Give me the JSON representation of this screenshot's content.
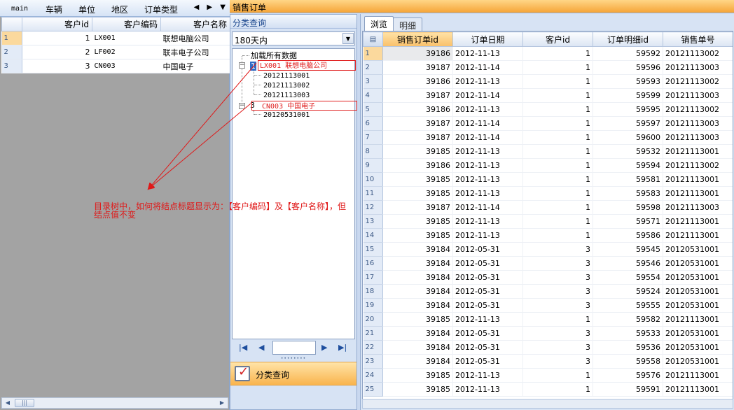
{
  "tabs": [
    {
      "label": "main"
    },
    {
      "label": "车辆"
    },
    {
      "label": "单位"
    },
    {
      "label": "地区"
    },
    {
      "label": "订单类型"
    }
  ],
  "tab_scroll_glyphs": "◀ ▶ ▼",
  "customer_grid": {
    "headers": [
      "客户id",
      "客户编码",
      "客户名称"
    ],
    "rows": [
      {
        "n": "1",
        "id": "1",
        "code": "LX001",
        "name": "联想电脑公司"
      },
      {
        "n": "2",
        "id": "2",
        "code": "LF002",
        "name": "联丰电子公司"
      },
      {
        "n": "3",
        "id": "3",
        "code": "CN003",
        "name": "中国电子"
      }
    ]
  },
  "window_title": "销售订单",
  "category_panel": {
    "title": "分类查询",
    "filter_value": "180天内",
    "tree": {
      "root_label": "加载所有数据",
      "node1_key": "1",
      "node1_caption": "LX001 联想电脑公司",
      "node1_children": [
        "20121113001",
        "20121113002",
        "20121113003"
      ],
      "node2_key": "3",
      "node2_caption": "CN003 中国电子",
      "node2_children": [
        "20120531001"
      ]
    },
    "action_label": "分类查询"
  },
  "order_tabs": {
    "browse": "浏览",
    "detail": "明细"
  },
  "order_grid": {
    "headers": [
      "销售订单id",
      "订单日期",
      "客户id",
      "订单明细id",
      "销售单号"
    ],
    "rows": [
      [
        "1",
        "39186",
        "2012-11-13",
        "1",
        "59592",
        "20121113002"
      ],
      [
        "2",
        "39187",
        "2012-11-14",
        "1",
        "59596",
        "20121113003"
      ],
      [
        "3",
        "39186",
        "2012-11-13",
        "1",
        "59593",
        "20121113002"
      ],
      [
        "4",
        "39187",
        "2012-11-14",
        "1",
        "59599",
        "20121113003"
      ],
      [
        "5",
        "39186",
        "2012-11-13",
        "1",
        "59595",
        "20121113002"
      ],
      [
        "6",
        "39187",
        "2012-11-14",
        "1",
        "59597",
        "20121113003"
      ],
      [
        "7",
        "39187",
        "2012-11-14",
        "1",
        "59600",
        "20121113003"
      ],
      [
        "8",
        "39185",
        "2012-11-13",
        "1",
        "59532",
        "20121113001"
      ],
      [
        "9",
        "39186",
        "2012-11-13",
        "1",
        "59594",
        "20121113002"
      ],
      [
        "10",
        "39185",
        "2012-11-13",
        "1",
        "59581",
        "20121113001"
      ],
      [
        "11",
        "39185",
        "2012-11-13",
        "1",
        "59583",
        "20121113001"
      ],
      [
        "12",
        "39187",
        "2012-11-14",
        "1",
        "59598",
        "20121113003"
      ],
      [
        "13",
        "39185",
        "2012-11-13",
        "1",
        "59571",
        "20121113001"
      ],
      [
        "14",
        "39185",
        "2012-11-13",
        "1",
        "59586",
        "20121113001"
      ],
      [
        "15",
        "39184",
        "2012-05-31",
        "3",
        "59545",
        "20120531001"
      ],
      [
        "16",
        "39184",
        "2012-05-31",
        "3",
        "59546",
        "20120531001"
      ],
      [
        "17",
        "39184",
        "2012-05-31",
        "3",
        "59554",
        "20120531001"
      ],
      [
        "18",
        "39184",
        "2012-05-31",
        "3",
        "59524",
        "20120531001"
      ],
      [
        "19",
        "39184",
        "2012-05-31",
        "3",
        "59555",
        "20120531001"
      ],
      [
        "20",
        "39185",
        "2012-11-13",
        "1",
        "59582",
        "20121113001"
      ],
      [
        "21",
        "39184",
        "2012-05-31",
        "3",
        "59533",
        "20120531001"
      ],
      [
        "22",
        "39184",
        "2012-05-31",
        "3",
        "59536",
        "20120531001"
      ],
      [
        "23",
        "39184",
        "2012-05-31",
        "3",
        "59558",
        "20120531001"
      ],
      [
        "24",
        "39185",
        "2012-11-13",
        "1",
        "59576",
        "20121113001"
      ],
      [
        "25",
        "39185",
        "2012-11-13",
        "1",
        "59591",
        "20121113001"
      ]
    ]
  },
  "annotation": {
    "line1": "目录树中，如何将结点标题显示为：【客户编码】及【客户名称】，但",
    "line2": "结点值不变",
    "color": "#e01818"
  }
}
